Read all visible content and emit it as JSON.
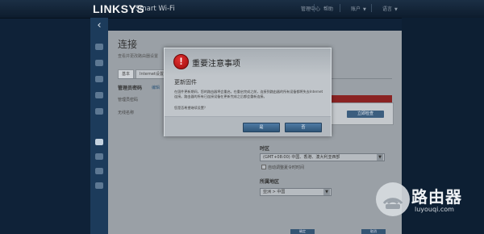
{
  "header": {
    "brand": "LINKSYS",
    "product": "Smart Wi-Fi",
    "links": [
      "管理中心",
      "帮助",
      "账户",
      "语言"
    ]
  },
  "page": {
    "title": "连接",
    "subtitle": "查看并更改路由器设置",
    "tabs": [
      "基本",
      "Internet设置"
    ],
    "router_name_label": "管理员密码",
    "router_name_value": "编辑",
    "firmware_label": "管理员密码",
    "firmware_hint_label": "无线名称",
    "update_button": "立即检查",
    "timezone_label": "时区",
    "timezone_value": "(GMT+08:00) 中国、香港、澳大利亚西部",
    "dst_label": "自动调整夏令时时间",
    "region_label": "所属地区",
    "region_value": "亚洲 > 中国",
    "ok_button": "确定",
    "cancel_button": "取消"
  },
  "modal": {
    "title": "重要注意事项",
    "subtitle": "更新固件",
    "body": "在固件更新期间，您的路由器将会重启。在重启完成之前，连接到路由器的所有设备都将失去Internet连接。路由器的所有已连接设备在更新完成之后都会重新连接。",
    "question": "您是否希望继续设置？",
    "ok_button": "是",
    "cancel_button": "否"
  },
  "watermark": {
    "main": "路由器",
    "url": "luyouqi.com"
  },
  "icons": [
    "back-arrow-icon",
    "warning-icon",
    "router-watermark-icon"
  ],
  "colors": {
    "header_bg": "#0d1c2d",
    "nav_bg": "#1c3b5b",
    "button_blue": "#3c6a94",
    "warning_red": "#c01818"
  }
}
